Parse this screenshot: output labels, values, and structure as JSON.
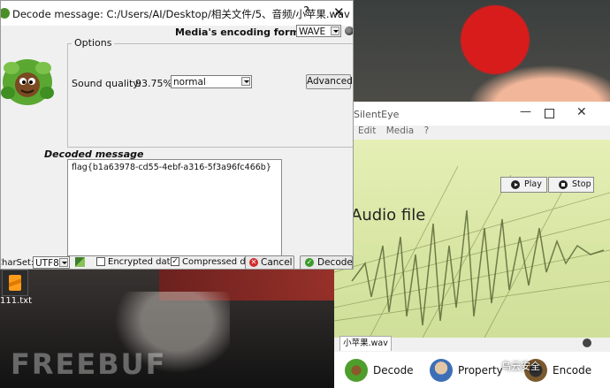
{
  "decode_dialog": {
    "title": "Decode message: C:/Users/AI/Desktop/相关文件/5、音频/小苹果.wav",
    "help_label": "?",
    "close_label": "✕",
    "encoding_format_label": "Media's encoding format :",
    "encoding_format_value": "WAVE",
    "options": {
      "legend": "Options",
      "sound_quality_label": "Sound quality:",
      "sound_quality_value": "93.75%",
      "quality_select_value": "normal",
      "advanced_label": "Advanced"
    },
    "decoded_message_label": "Decoded message",
    "decoded_text": "flag{b1a63978-cd55-4ebf-a316-5f3a96fc466b}",
    "charset_label": "CharSet:",
    "charset_value": "UTF8",
    "encrypted_label": "Encrypted data",
    "encrypted_checked": false,
    "compressed_label": "Compressed dat",
    "compressed_checked": true,
    "compressed_mark": "✓",
    "cancel_label": "Cancel",
    "cancel_icon_glyph": "✕",
    "decode_label": "Decode",
    "decode_icon_glyph": "✓"
  },
  "silenteye": {
    "title": "SilentEye",
    "min_label": "—",
    "close_label": "✕",
    "menu": [
      "Edit",
      "Media",
      "?"
    ],
    "canvas_title": "Audio file",
    "play_label": "Play",
    "stop_label": "Stop",
    "tab_label": "小苹果.wav",
    "actions": [
      {
        "label": "Decode",
        "icon": "decode-icon"
      },
      {
        "label": "Property",
        "icon": "property-icon"
      },
      {
        "label": "Encode",
        "icon": "encode-icon"
      }
    ],
    "overlay_text": "乌云安全"
  },
  "desktop": {
    "file_label": "111.txt",
    "watermark_text": "FREEBUF"
  }
}
